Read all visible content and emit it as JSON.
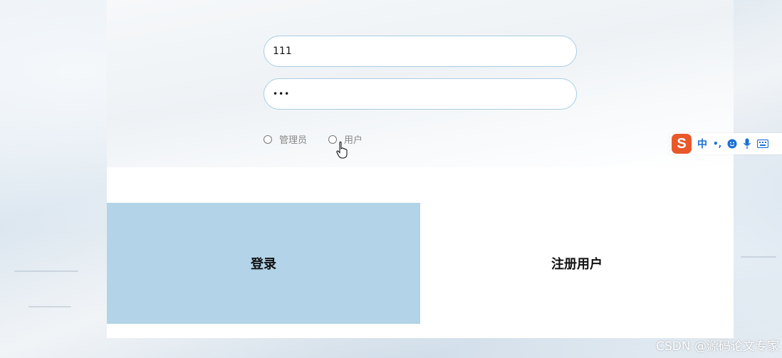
{
  "login_form": {
    "username_value": "111",
    "password_value": "•••",
    "roles": [
      {
        "label": "管理员"
      },
      {
        "label": "用户"
      }
    ]
  },
  "actions": {
    "login_label": "登录",
    "register_label": "注册用户"
  },
  "ime_toolbar": {
    "logo": "S",
    "lang": "中",
    "punct": "•,",
    "items": [
      "smiley-icon",
      "microphone-icon",
      "keyboard-icon"
    ]
  },
  "watermark": "CSDN @源码论文专家",
  "colors": {
    "login_button": "#b2d3e8",
    "input_border": "#a9cde4",
    "ime_logo": "#e8582a",
    "ime_icons": "#1a6fd6"
  }
}
